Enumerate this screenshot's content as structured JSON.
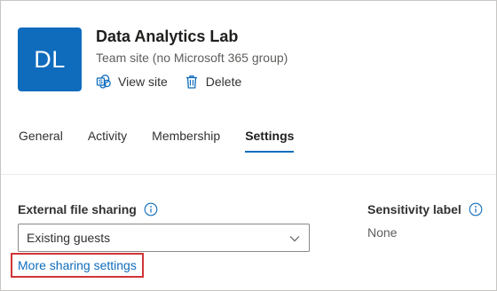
{
  "site": {
    "initials": "DL",
    "avatar_color": "#0f6cbd",
    "title": "Data Analytics Lab",
    "subtitle": "Team site (no Microsoft 365 group)"
  },
  "actions": {
    "view_site": {
      "label": "View site",
      "icon": "sharepoint-icon"
    },
    "delete": {
      "label": "Delete",
      "icon": "trash-icon"
    }
  },
  "tabs": [
    {
      "label": "General",
      "active": false
    },
    {
      "label": "Activity",
      "active": false
    },
    {
      "label": "Membership",
      "active": false
    },
    {
      "label": "Settings",
      "active": true
    }
  ],
  "settings": {
    "external_sharing": {
      "label": "External file sharing",
      "info_icon": "info-icon",
      "selected": "Existing guests"
    },
    "more_link": "More sharing settings",
    "sensitivity": {
      "label": "Sensitivity label",
      "info_icon": "info-icon",
      "value": "None"
    }
  },
  "colors": {
    "accent": "#0f6cbd",
    "highlight_box": "#d13438"
  }
}
